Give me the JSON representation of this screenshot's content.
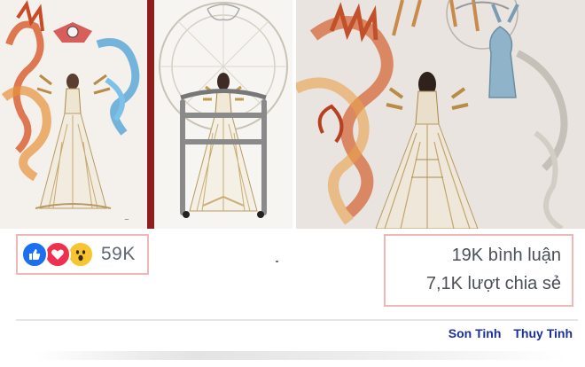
{
  "illustrations": [
    {
      "name": "sketch-left"
    },
    {
      "name": "sketch-middle"
    },
    {
      "name": "sketch-right"
    }
  ],
  "reactions": {
    "icons": [
      "like-icon",
      "love-icon",
      "wow-icon"
    ],
    "colors": {
      "like": "#1d6ff2",
      "love": "#f0304f",
      "wow": "#f7c530"
    },
    "count": "59K"
  },
  "stats": {
    "comments": "19K bình luận",
    "shares": "7,1K lượt chia sẻ"
  },
  "credits": {
    "left": "Son Tinh",
    "right": "Thuy Tinh"
  },
  "highlight_color": "#f1b6b6",
  "credit_color": "#1a2fa0"
}
